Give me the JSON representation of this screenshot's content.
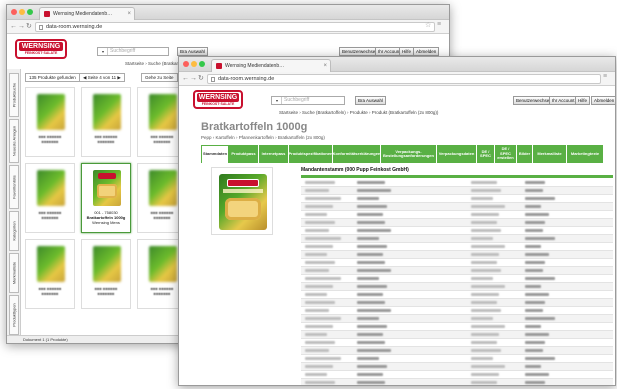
{
  "back_window": {
    "tab_title": "Wernsing Mediendatenb…",
    "url": "data-room.wernsing.de",
    "logo_name": "WERNSING",
    "logo_sub": "FEINKOST·SALATE",
    "search_placeholder": "Suchbegriff",
    "search_button": "Bra Auswahl",
    "user_buttons": [
      "Benutzerwechsel",
      "Ihr Account",
      "Hilfe",
      "Abmelden"
    ],
    "breadcrumb": "Startseite › Suche (Bratkartoffeln) › Produkte",
    "found_label": "135 Produkte gefunden",
    "page_label": "Seite 4 von 11",
    "goto_label": "Gehe zu Seite",
    "left_tabs": [
      "Produktsuche",
      "Neueste Anlagen",
      "Favoritenliste",
      "Kategorien",
      "Merkmalliste",
      "Produkttypen"
    ],
    "selected_product": {
      "id": "001 - 758030",
      "name": "Bratkartoffeln 1000g",
      "brand": "Wernsing Mens"
    },
    "status": "Dokument 1 (1 Produkte)"
  },
  "front_window": {
    "tab_title": "Wernsing Mediendatenb…",
    "url": "data-room.wernsing.de",
    "search_placeholder": "Suchbegriff",
    "search_button": "Bra Auswahl",
    "user_buttons": [
      "Benutzerwechsel",
      "Ihr Account",
      "Hilfe",
      "Abmelden"
    ],
    "breadcrumb": "Startseite › Suche (Bratkartoffeln) › Produkte › Produkt (Bratkartoffeln (2x 800g))",
    "product_title": "Bratkartoffeln 1000g",
    "product_sub": "Pepp › Kartoffeln › Pfannenkartoffeln › Bratkartoffeln (2x 800g)",
    "tabs": [
      "Stammdaten",
      "Produktpass",
      "Internetpass",
      "Produktspezifikationen",
      "Konformitätserklärungen",
      "Verpackungs-einstellungen",
      "Verpackungs-Bestellungsanforderungen",
      "Verpackungsdaten",
      "DE / SPEC",
      "DE / SPEC erstellen",
      "Bilder",
      "Merkmalliste",
      "Marketingtexte"
    ],
    "master_title": "Mandantenstamm (000 Pupp Feinkost GmbH)"
  }
}
